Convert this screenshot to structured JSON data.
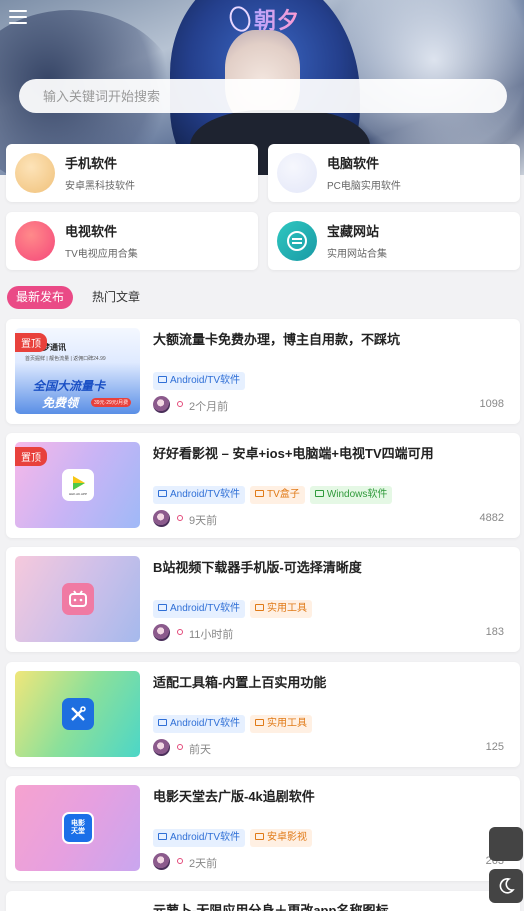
{
  "search": {
    "placeholder": "输入关键词开始搜索"
  },
  "logo": {
    "text": "朝夕"
  },
  "categories": [
    {
      "title": "手机软件",
      "desc": "安卓黑科技软件"
    },
    {
      "title": "电脑软件",
      "desc": "PC电脑实用软件"
    },
    {
      "title": "电视软件",
      "desc": "TV电视应用合集"
    },
    {
      "title": "宝藏网站",
      "desc": "实用网站合集"
    }
  ],
  "tabs": [
    "最新发布",
    "热门文章"
  ],
  "pin_label": "置顶",
  "posts": [
    {
      "title": "大额流量卡免费办理，博主自用款，不踩坑",
      "tags": [
        "Android/TV软件"
      ],
      "time": "2个月前",
      "views": "1098",
      "thumb_text": {
        "brand": "梦通讯",
        "sub": "首页掘鲜 | 靓色流量 | 返佣口碑24.99",
        "main": "全国大流量卡",
        "main2": "免费领",
        "badge": "39元·29元/月费"
      }
    },
    {
      "title": "好好看影视 – 安卓+ios+电脑端+电视TV四端可用",
      "tags": [
        "Android/TV软件",
        "TV盒子",
        "Windows软件"
      ],
      "time": "9天前",
      "views": "4882",
      "thumb_text": {
        "app": "HHK.AK.APP"
      }
    },
    {
      "title": "B站视频下载器手机版-可选择清晰度",
      "tags": [
        "Android/TV软件",
        "实用工具"
      ],
      "time": "11小时前",
      "views": "183"
    },
    {
      "title": "适配工具箱-内置上百实用功能",
      "tags": [
        "Android/TV软件",
        "实用工具"
      ],
      "time": "前天",
      "views": "125"
    },
    {
      "title": "电影天堂去广版-4k追剧软件",
      "tags": [
        "Android/TV软件",
        "安卓影视"
      ],
      "time": "2天前",
      "views": "263",
      "thumb_text": {
        "app1": "电影",
        "app2": "天堂"
      }
    },
    {
      "title": "元萝卜-无限应用分身＋更改app名称图标"
    }
  ],
  "colors": {
    "accent": "#ea4a86",
    "pin": "#e8413c",
    "tag_blue": "#2f6fd6",
    "tag_orange": "#e07a17",
    "tag_green": "#2f9a3a"
  }
}
